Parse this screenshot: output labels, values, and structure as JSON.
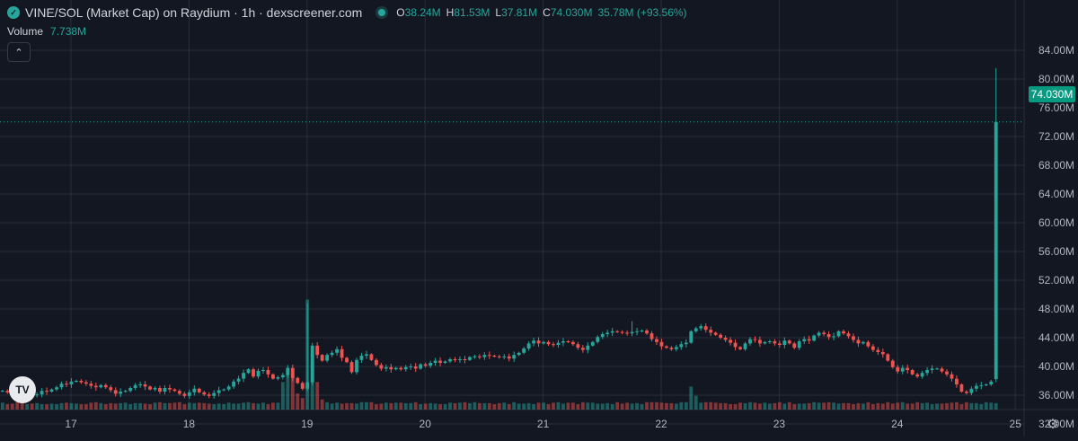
{
  "header": {
    "pair": "VINE/SOL (Market Cap) on Raydium · 1h · dexscreener.com",
    "open_label": "O",
    "open": "38.24M",
    "high_label": "H",
    "high": "81.53M",
    "low_label": "L",
    "low": "37.81M",
    "close_label": "C",
    "close": "74.030M",
    "change": "35.78M (+93.56%)"
  },
  "volume": {
    "label": "Volume",
    "value": "7.738M"
  },
  "price_badge": "74.030M",
  "icons": {
    "logo": "vine-logo-icon",
    "collapse": "chevron-up-icon",
    "tv": "tradingview-logo-icon",
    "settings": "gear-icon"
  },
  "colors": {
    "up": "#26a69a",
    "down": "#ef5350",
    "background": "#131722",
    "grid": "#2a2e39",
    "badge": "#089981"
  },
  "chart_data": {
    "type": "candlestick",
    "x_ticks": [
      "17",
      "18",
      "19",
      "20",
      "21",
      "22",
      "23",
      "24",
      "25"
    ],
    "y_ticks": [
      "32.00M",
      "36.00M",
      "40.00M",
      "44.00M",
      "48.00M",
      "52.00M",
      "56.00M",
      "60.00M",
      "64.00M",
      "68.00M",
      "72.00M",
      "76.00M",
      "80.00M",
      "84.00M"
    ],
    "ylim": [
      30,
      86
    ],
    "y_unit": "M",
    "x_start_day": 16.42,
    "x_end_day": 25.3,
    "bars_per_day": 24,
    "last_price": 74.03,
    "closes": [
      36.6,
      36.4,
      36.3,
      36.2,
      36.1,
      36.3,
      36.0,
      36.1,
      36.6,
      36.5,
      36.8,
      37.1,
      37.6,
      37.5,
      37.9,
      38.0,
      37.8,
      37.6,
      37.3,
      37.1,
      37.4,
      37.1,
      36.7,
      36.2,
      36.5,
      36.6,
      37.0,
      37.4,
      37.5,
      37.2,
      36.8,
      37.0,
      36.5,
      37.0,
      36.8,
      36.6,
      36.2,
      35.9,
      36.4,
      36.9,
      36.4,
      36.1,
      35.9,
      36.3,
      36.7,
      36.8,
      37.2,
      37.9,
      38.3,
      39.1,
      39.6,
      38.6,
      39.4,
      39.5,
      38.9,
      38.3,
      38.5,
      38.8,
      39.8,
      38.4,
      37.7,
      36.9,
      37.8,
      42.9,
      41.6,
      40.8,
      41.6,
      41.9,
      42.4,
      41.2,
      40.6,
      39.2,
      40.9,
      41.5,
      41.7,
      40.9,
      40.2,
      39.7,
      39.9,
      39.6,
      39.8,
      39.6,
      39.9,
      40.0,
      39.7,
      40.3,
      40.1,
      40.5,
      40.8,
      40.5,
      40.7,
      41.0,
      40.9,
      41.0,
      40.9,
      41.3,
      41.4,
      41.3,
      41.6,
      41.5,
      41.4,
      41.3,
      41.4,
      41.1,
      41.6,
      41.9,
      42.5,
      43.2,
      43.6,
      43.2,
      43.4,
      43.1,
      43.0,
      43.3,
      43.5,
      43.4,
      43.1,
      42.6,
      42.3,
      42.9,
      43.4,
      44.1,
      44.5,
      44.7,
      44.9,
      44.8,
      44.7,
      44.6,
      44.8,
      44.9,
      45.0,
      44.6,
      43.8,
      43.4,
      42.8,
      42.6,
      42.4,
      42.7,
      43.1,
      43.3,
      44.9,
      45.3,
      45.6,
      45.1,
      44.7,
      44.4,
      44.0,
      43.7,
      43.3,
      42.7,
      42.4,
      43.2,
      43.8,
      43.7,
      43.2,
      43.4,
      43.5,
      43.2,
      43.0,
      43.6,
      43.2,
      42.6,
      43.5,
      43.8,
      43.6,
      44.3,
      44.7,
      44.5,
      44.1,
      44.2,
      44.9,
      44.6,
      44.2,
      43.7,
      43.2,
      43.4,
      42.8,
      42.3,
      42.0,
      41.7,
      40.8,
      39.9,
      39.3,
      39.8,
      39.5,
      38.9,
      38.6,
      39.1,
      39.5,
      39.7,
      39.7,
      39.3,
      38.9,
      38.3,
      37.5,
      36.5,
      36.3,
      36.9,
      37.3,
      37.4,
      37.5,
      37.9,
      74.03
    ],
    "spike": {
      "open": 38.24,
      "high": 81.53,
      "low": 37.81,
      "close": 74.03
    },
    "volumes": [
      0.15,
      0.12,
      0.13,
      0.16,
      0.15,
      0.12,
      0.13,
      0.14,
      0.12,
      0.12,
      0.13,
      0.12,
      0.14,
      0.15,
      0.14,
      0.13,
      0.12,
      0.12,
      0.15,
      0.16,
      0.14,
      0.12,
      0.14,
      0.13,
      0.14,
      0.15,
      0.12,
      0.14,
      0.14,
      0.13,
      0.12,
      0.15,
      0.16,
      0.14,
      0.14,
      0.15,
      0.16,
      0.12,
      0.15,
      0.14,
      0.15,
      0.14,
      0.13,
      0.12,
      0.13,
      0.12,
      0.15,
      0.13,
      0.13,
      0.15,
      0.16,
      0.14,
      0.13,
      0.15,
      0.12,
      0.15,
      0.15,
      0.6,
      0.9,
      0.7,
      0.35,
      0.25,
      2.4,
      1.2,
      0.6,
      0.22,
      0.16,
      0.13,
      0.15,
      0.13,
      0.14,
      0.14,
      0.13,
      0.16,
      0.16,
      0.16,
      0.12,
      0.13,
      0.15,
      0.14,
      0.15,
      0.15,
      0.14,
      0.14,
      0.16,
      0.12,
      0.13,
      0.14,
      0.13,
      0.12,
      0.12,
      0.15,
      0.14,
      0.15,
      0.16,
      0.14,
      0.16,
      0.14,
      0.14,
      0.14,
      0.12,
      0.14,
      0.15,
      0.12,
      0.16,
      0.13,
      0.13,
      0.14,
      0.12,
      0.15,
      0.15,
      0.12,
      0.15,
      0.16,
      0.13,
      0.15,
      0.15,
      0.12,
      0.16,
      0.15,
      0.15,
      0.13,
      0.13,
      0.14,
      0.12,
      0.16,
      0.13,
      0.15,
      0.13,
      0.14,
      0.12,
      0.16,
      0.16,
      0.16,
      0.15,
      0.14,
      0.14,
      0.13,
      0.16,
      0.16,
      0.5,
      0.3,
      0.15,
      0.16,
      0.16,
      0.15,
      0.14,
      0.14,
      0.12,
      0.12,
      0.15,
      0.14,
      0.16,
      0.15,
      0.13,
      0.15,
      0.13,
      0.14,
      0.16,
      0.13,
      0.16,
      0.12,
      0.13,
      0.13,
      0.14,
      0.16,
      0.15,
      0.15,
      0.16,
      0.15,
      0.13,
      0.14,
      0.14,
      0.12,
      0.14,
      0.13,
      0.16,
      0.12,
      0.14,
      0.13,
      0.16,
      0.13,
      0.15,
      0.16,
      0.13,
      0.13,
      0.16,
      0.14,
      0.15,
      0.12,
      0.13,
      0.13,
      0.14,
      0.15,
      0.16,
      0.12,
      0.16,
      0.14,
      0.14,
      0.12,
      0.16,
      0.15,
      0.14,
      0.12,
      0.13,
      7.738
    ],
    "volume_max": 7.738
  }
}
